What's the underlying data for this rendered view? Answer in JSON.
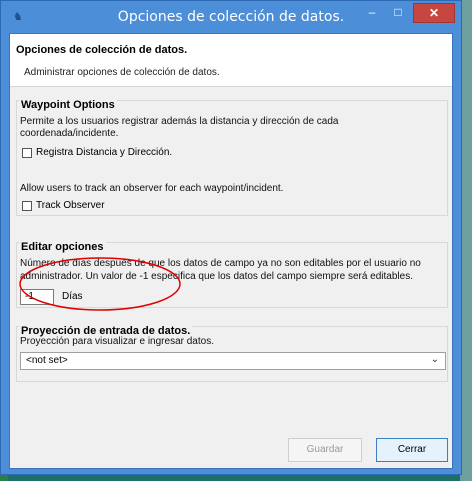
{
  "window": {
    "title": "Opciones de colección de datos."
  },
  "titlebar_buttons": {
    "minimize": "–",
    "maximize": "□",
    "close": "✕"
  },
  "header": {
    "title": "Opciones de colección de datos.",
    "description": "Administrar opciones de colección de datos."
  },
  "waypoint": {
    "title": "Waypoint Options",
    "desc_line1": "Permite a los usuarios registrar además la distancia y dirección de cada",
    "desc_line2": "coordenada/incidente.",
    "checkbox1_label": "Registra Distancia y Dirección.",
    "observer_desc": "Allow users to track an observer for each waypoint/incident.",
    "checkbox2_label": "Track Observer"
  },
  "edit": {
    "title": "Editar opciones",
    "desc_line1": "Número de días después de que los datos de campo ya no son editables por el usuario no",
    "desc_line2": "administrador. Un valor de -1 especifica que los datos del campo siempre será editables.",
    "value": "-1",
    "unit": "Días"
  },
  "projection": {
    "title": "Proyección de entrada de datos.",
    "desc": "Proyección para visualizar e ingresar datos.",
    "selected": "<not set>"
  },
  "footer": {
    "guardar": "Guardar",
    "cerrar": "Cerrar"
  },
  "colors": {
    "titlebar": "#4c8fd8",
    "close_button": "#c7463f",
    "annotation": "#e00000"
  }
}
